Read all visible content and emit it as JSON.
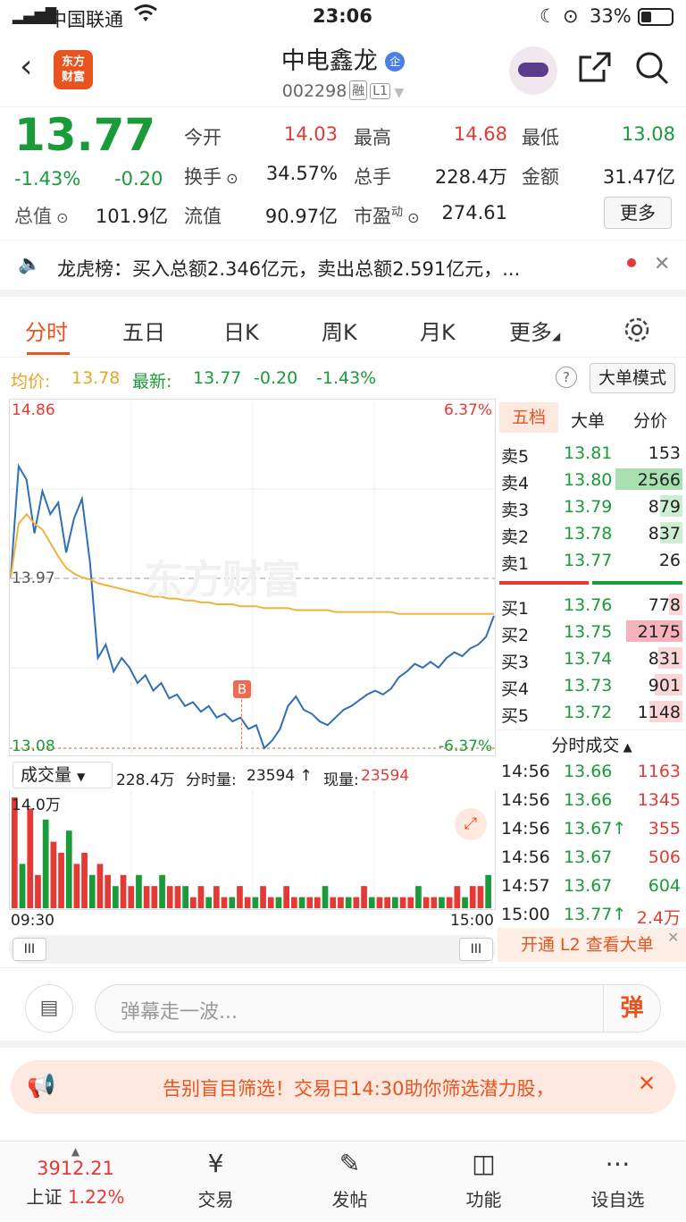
{
  "status_bar": {
    "carrier": "中国联通",
    "time": "23:06",
    "battery": "33%"
  },
  "header": {
    "logo_line1": "东方",
    "logo_line2": "财富",
    "title": "中电鑫龙",
    "title_badge": "企",
    "code": "002298",
    "tag1": "融",
    "tag2": "L1"
  },
  "quote": {
    "price": "13.77",
    "change_pct": "-1.43%",
    "change": "-0.20",
    "open_label": "今开",
    "open": "14.03",
    "high_label": "最高",
    "high": "14.68",
    "low_label": "最低",
    "low": "13.08",
    "turnover_label": "换手",
    "turnover": "34.57%",
    "volume_label": "总手",
    "volume": "228.4万",
    "amount_label": "金额",
    "amount": "31.47亿",
    "mcap_label": "总值",
    "mcap": "101.9亿",
    "float_label": "流值",
    "float": "90.97亿",
    "pe_label": "市盈",
    "pe_sup": "动",
    "pe": "274.61",
    "more": "更多"
  },
  "notice": {
    "text": "龙虎榜：买入总额2.346亿元，卖出总额2.591亿元，..."
  },
  "tabs": [
    "分时",
    "五日",
    "日K",
    "周K",
    "月K",
    "更多"
  ],
  "price_line": {
    "avg_label": "均价:",
    "avg": "13.78",
    "latest_label": "最新:",
    "latest": "13.77",
    "chg": "-0.20",
    "pct": "-1.43%",
    "mode_btn": "大单模式"
  },
  "chart_labels": {
    "top_price": "14.86",
    "top_pct": "6.37%",
    "mid_price": "13.97",
    "bot_price": "13.08",
    "bot_pct": "-6.37%",
    "watermark": "东方财富",
    "buy_marker": "B"
  },
  "chart_data": {
    "type": "line",
    "ylim": [
      13.08,
      14.86
    ],
    "series": [
      {
        "values": [
          13.97,
          14.55,
          14.48,
          14.2,
          14.42,
          14.3,
          14.36,
          14.1,
          14.28,
          14.38,
          14.05,
          13.55,
          13.62,
          13.48,
          13.55,
          13.5,
          13.42,
          13.46,
          13.38,
          13.42,
          13.34,
          13.36,
          13.3,
          13.32,
          13.27,
          13.3,
          13.24,
          13.26,
          13.22,
          13.24,
          13.18,
          13.2,
          13.08,
          13.12,
          13.18,
          13.3,
          13.35,
          13.28,
          13.26,
          13.22,
          13.2,
          13.24,
          13.28,
          13.3,
          13.33,
          13.36,
          13.38,
          13.36,
          13.39,
          13.45,
          13.48,
          13.52,
          13.5,
          13.53,
          13.5,
          13.55,
          13.58,
          13.56,
          13.6,
          13.62,
          13.66,
          13.77
        ]
      },
      {
        "values": [
          13.97,
          14.25,
          14.3,
          14.25,
          14.22,
          14.15,
          14.08,
          14.02,
          13.99,
          13.97,
          13.96,
          13.94,
          13.93,
          13.92,
          13.91,
          13.9,
          13.89,
          13.88,
          13.87,
          13.87,
          13.86,
          13.86,
          13.85,
          13.85,
          13.84,
          13.84,
          13.83,
          13.83,
          13.83,
          13.82,
          13.82,
          13.82,
          13.81,
          13.81,
          13.81,
          13.81,
          13.8,
          13.8,
          13.8,
          13.8,
          13.8,
          13.79,
          13.79,
          13.79,
          13.79,
          13.79,
          13.79,
          13.79,
          13.79,
          13.78,
          13.78,
          13.78,
          13.78,
          13.78,
          13.78,
          13.78,
          13.78,
          13.78,
          13.78,
          13.78,
          13.78,
          13.78
        ]
      }
    ],
    "volume": [
      10,
      4,
      9,
      3,
      8,
      6,
      5,
      7,
      4,
      5,
      3,
      4,
      3,
      2,
      3,
      2,
      3,
      2,
      2,
      3,
      2,
      2,
      2,
      1,
      2,
      1,
      2,
      1,
      1,
      2,
      1,
      1,
      2,
      1,
      1,
      2,
      1,
      1,
      1,
      1,
      2,
      1,
      1,
      1,
      1,
      2,
      1,
      1,
      1,
      1,
      1,
      1,
      2,
      1,
      1,
      1,
      1,
      2,
      1,
      2,
      2,
      3
    ]
  },
  "vol_panel": {
    "dropdown": "成交量",
    "total": "228.4万",
    "tick_label": "分时量:",
    "tick": "23594",
    "now_label": "现量:",
    "now": "23594",
    "max": "14.0万",
    "t_start": "09:30",
    "t_end": "15:00"
  },
  "book": {
    "tabs": [
      "五档",
      "大单",
      "分价"
    ],
    "asks": [
      {
        "l": "卖5",
        "p": "13.81",
        "v": "153"
      },
      {
        "l": "卖4",
        "p": "13.80",
        "v": "2566"
      },
      {
        "l": "卖3",
        "p": "13.79",
        "v": "879"
      },
      {
        "l": "卖2",
        "p": "13.78",
        "v": "837"
      },
      {
        "l": "卖1",
        "p": "13.77",
        "v": "26"
      }
    ],
    "bids": [
      {
        "l": "买1",
        "p": "13.76",
        "v": "778"
      },
      {
        "l": "买2",
        "p": "13.75",
        "v": "2175"
      },
      {
        "l": "买3",
        "p": "13.74",
        "v": "831"
      },
      {
        "l": "买4",
        "p": "13.73",
        "v": "901"
      },
      {
        "l": "买5",
        "p": "13.72",
        "v": "1148"
      }
    ],
    "trades_title": "分时成交",
    "trades": [
      {
        "t": "14:56",
        "p": "13.66",
        "v": "1163"
      },
      {
        "t": "14:56",
        "p": "13.66",
        "v": "1345"
      },
      {
        "t": "14:56",
        "p": "13.67↑",
        "v": "355"
      },
      {
        "t": "14:56",
        "p": "13.67",
        "v": "506"
      },
      {
        "t": "14:57",
        "p": "13.67",
        "v": "604"
      },
      {
        "t": "15:00",
        "p": "13.77↑",
        "v": "2.4万"
      }
    ],
    "l2": "开通 L2 查看大单"
  },
  "comment": {
    "placeholder": "弹幕走一波...",
    "danmu": "弹"
  },
  "banner": {
    "text": "告别盲目筛选！交易日14:30助你筛选潜力股，"
  },
  "nav": {
    "index_val": "3912.21",
    "index_name": "上证",
    "index_pct": "1.22%",
    "trade": "交易",
    "post": "发帖",
    "func": "功能",
    "watch": "设自选"
  }
}
